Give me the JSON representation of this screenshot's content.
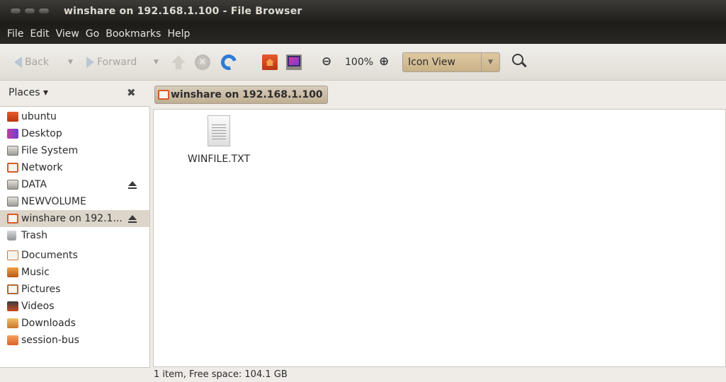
{
  "window": {
    "title": "winshare on 192.168.1.100 - File Browser"
  },
  "menubar": {
    "items": [
      "File",
      "Edit",
      "View",
      "Go",
      "Bookmarks",
      "Help"
    ]
  },
  "toolbar": {
    "back_label": "Back",
    "forward_label": "Forward",
    "zoom_level": "100%",
    "view_mode": "Icon View"
  },
  "sidebar": {
    "header": "Places ▾",
    "items": [
      {
        "label": "ubuntu",
        "icon": "home-folder-icon"
      },
      {
        "label": "Desktop",
        "icon": "desktop-icon"
      },
      {
        "label": "File System",
        "icon": "drive-icon"
      },
      {
        "label": "Network",
        "icon": "network-icon"
      },
      {
        "label": "DATA",
        "icon": "drive-icon",
        "eject": true
      },
      {
        "label": "NEWVOLUME",
        "icon": "drive-icon"
      },
      {
        "label": "winshare on 192.1...",
        "icon": "network-share-icon",
        "eject": true,
        "selected": true
      },
      {
        "label": "Trash",
        "icon": "trash-icon"
      },
      {
        "label": "Documents",
        "icon": "documents-folder-icon"
      },
      {
        "label": "Music",
        "icon": "music-folder-icon"
      },
      {
        "label": "Pictures",
        "icon": "pictures-folder-icon"
      },
      {
        "label": "Videos",
        "icon": "videos-folder-icon"
      },
      {
        "label": "Downloads",
        "icon": "downloads-folder-icon"
      },
      {
        "label": "session-bus",
        "icon": "folder-icon"
      }
    ]
  },
  "location": {
    "crumb": "winshare on 192.168.1.100"
  },
  "files": [
    {
      "name": "WINFILE.TXT",
      "icon": "text-file-icon"
    }
  ],
  "status": {
    "text": "1 item, Free space: 104.1 GB"
  }
}
